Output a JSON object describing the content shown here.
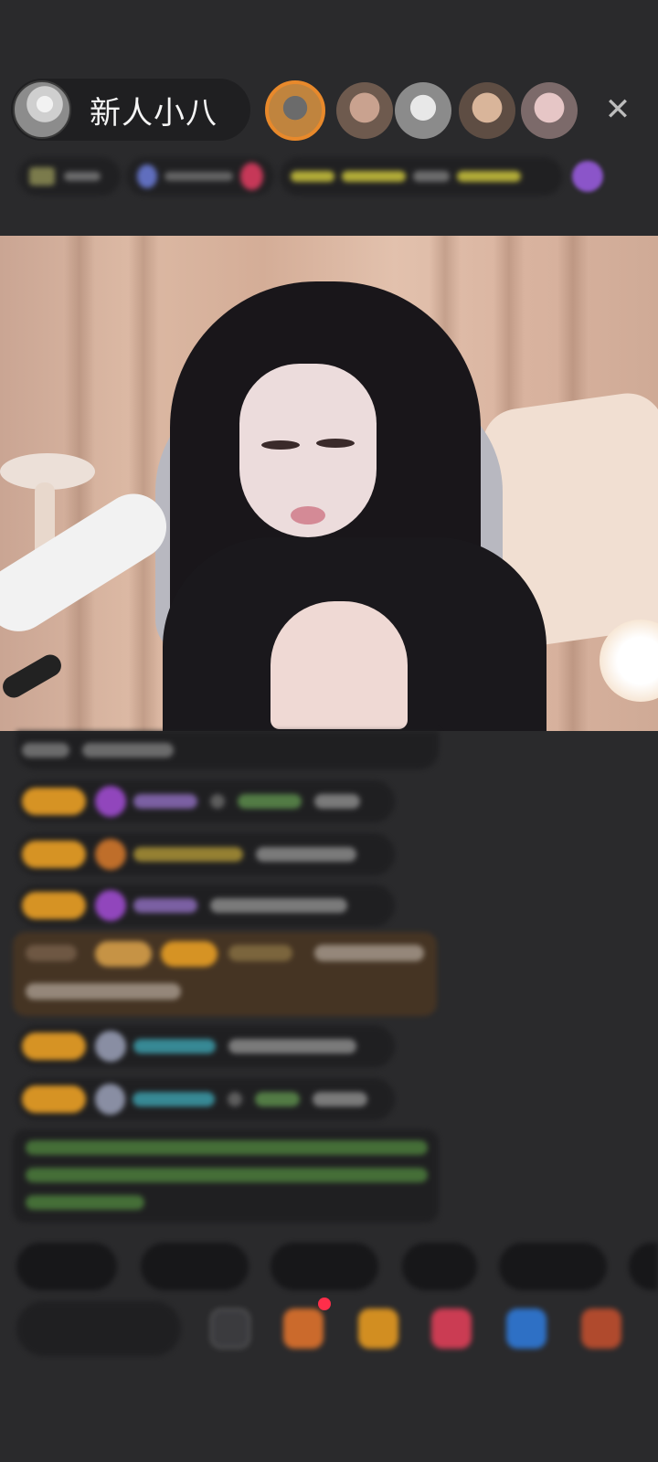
{
  "header": {
    "streamer_name": "新人小八",
    "close_icon": "close-icon",
    "viewers": [
      "viewer-avatar",
      "viewer-avatar",
      "viewer-avatar",
      "viewer-avatar",
      "viewer-avatar"
    ]
  },
  "colors": {
    "level_badge": "#f5a623",
    "chat_bg": "#1e1e20",
    "accent_green": "#8bc34a"
  }
}
